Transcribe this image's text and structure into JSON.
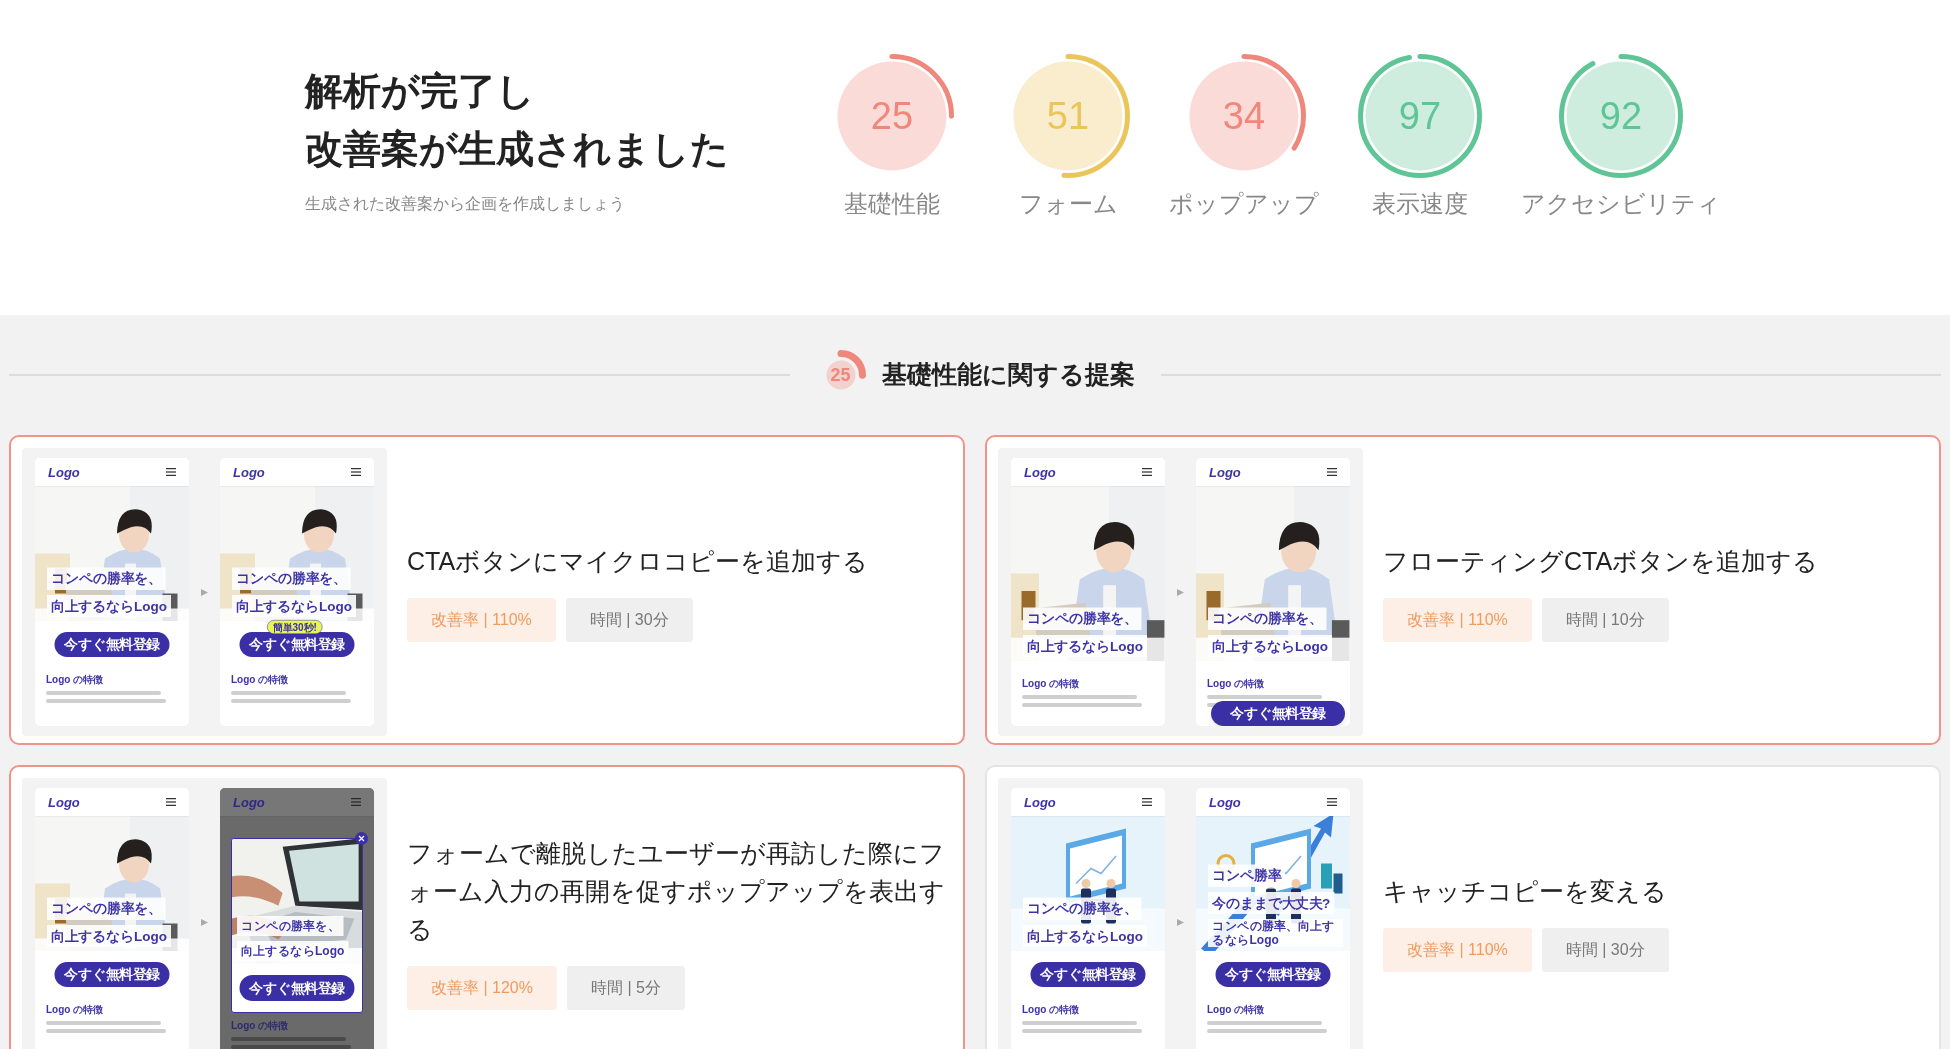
{
  "header": {
    "title_lines": [
      "解析が完了し",
      "改善案が生成されました"
    ],
    "subtitle": "生成された改善案から企画を作成しましょう"
  },
  "scores": [
    {
      "value": "25",
      "label": "基礎性能",
      "color": "#f0877c"
    },
    {
      "value": "51",
      "label": "フォーム",
      "color": "#ebc45a"
    },
    {
      "value": "34",
      "label": "ポップアップ",
      "color": "#f0877c"
    },
    {
      "value": "97",
      "label": "表示速度",
      "color": "#5fc596"
    },
    {
      "value": "92",
      "label": "アクセシビリティ",
      "color": "#5fc596"
    }
  ],
  "section": {
    "score": {
      "value": "25",
      "color": "#f0877c"
    },
    "title": "基礎性能に関する提案"
  },
  "cards": [
    {
      "title": "CTAボタンにマイクロコピーを追加する",
      "improvement": "改善率 | 110%",
      "time": "時間 | 30分",
      "highlighted": true,
      "mockups": [
        {
          "kind": "standard",
          "logo": "Logo",
          "headline": [
            "コンペの勝率を、",
            "向上するならLogo"
          ],
          "cta": "今すぐ無料登録",
          "feature_title": "Logo の特徴"
        },
        {
          "kind": "standard",
          "logo": "Logo",
          "headline": [
            "コンペの勝率を、",
            "向上するならLogo"
          ],
          "badge": "簡単30秒!",
          "cta": "今すぐ無料登録",
          "feature_title": "Logo の特徴"
        }
      ]
    },
    {
      "title": "フローティングCTAボタンを追加する",
      "improvement": "改善率 | 110%",
      "time": "時間 | 10分",
      "highlighted": true,
      "mockups": [
        {
          "kind": "plain",
          "logo": "Logo",
          "headline": [
            "コンペの勝率を、",
            "向上するならLogo"
          ],
          "feature_title": "Logo の特徴"
        },
        {
          "kind": "floating",
          "logo": "Logo",
          "headline": [
            "コンペの勝率を、",
            "向上するならLogo"
          ],
          "cta": "今すぐ無料登録",
          "feature_title": "Logo の特徴"
        }
      ]
    },
    {
      "title": "フォームで離脱したユーザーが再訪した際にフォーム入力の再開を促すポップアップを表出する",
      "improvement": "改善率 | 120%",
      "time": "時間 | 5分",
      "highlighted": true,
      "mockups": [
        {
          "kind": "standard",
          "logo": "Logo",
          "headline": [
            "コンペの勝率を、",
            "向上するならLogo"
          ],
          "cta": "今すぐ無料登録",
          "feature_title": "Logo の特徴"
        },
        {
          "kind": "popup",
          "logo": "Logo",
          "headline": [
            "コンペの勝率を、",
            "向上するならLogo"
          ],
          "cta": "今すぐ無料登録",
          "feature_title": "Logo の特徴"
        }
      ]
    },
    {
      "title": "キャッチコピーを変える",
      "improvement": "改善率 | 110%",
      "time": "時間 | 30分",
      "highlighted": false,
      "mockups": [
        {
          "kind": "standard",
          "logo": "Logo",
          "headline": [
            "コンペの勝率を、",
            "向上するならLogo"
          ],
          "cta": "今すぐ無料登録",
          "feature_title": "Logo の特徴"
        },
        {
          "kind": "standard",
          "logo": "Logo",
          "headline": [
            "コンペ勝率",
            "今のままで大丈夫?"
          ],
          "subline": "コンペの勝率、向上するならLogo",
          "cta": "今すぐ無料登録",
          "feature_title": "Logo の特徴"
        }
      ]
    }
  ]
}
